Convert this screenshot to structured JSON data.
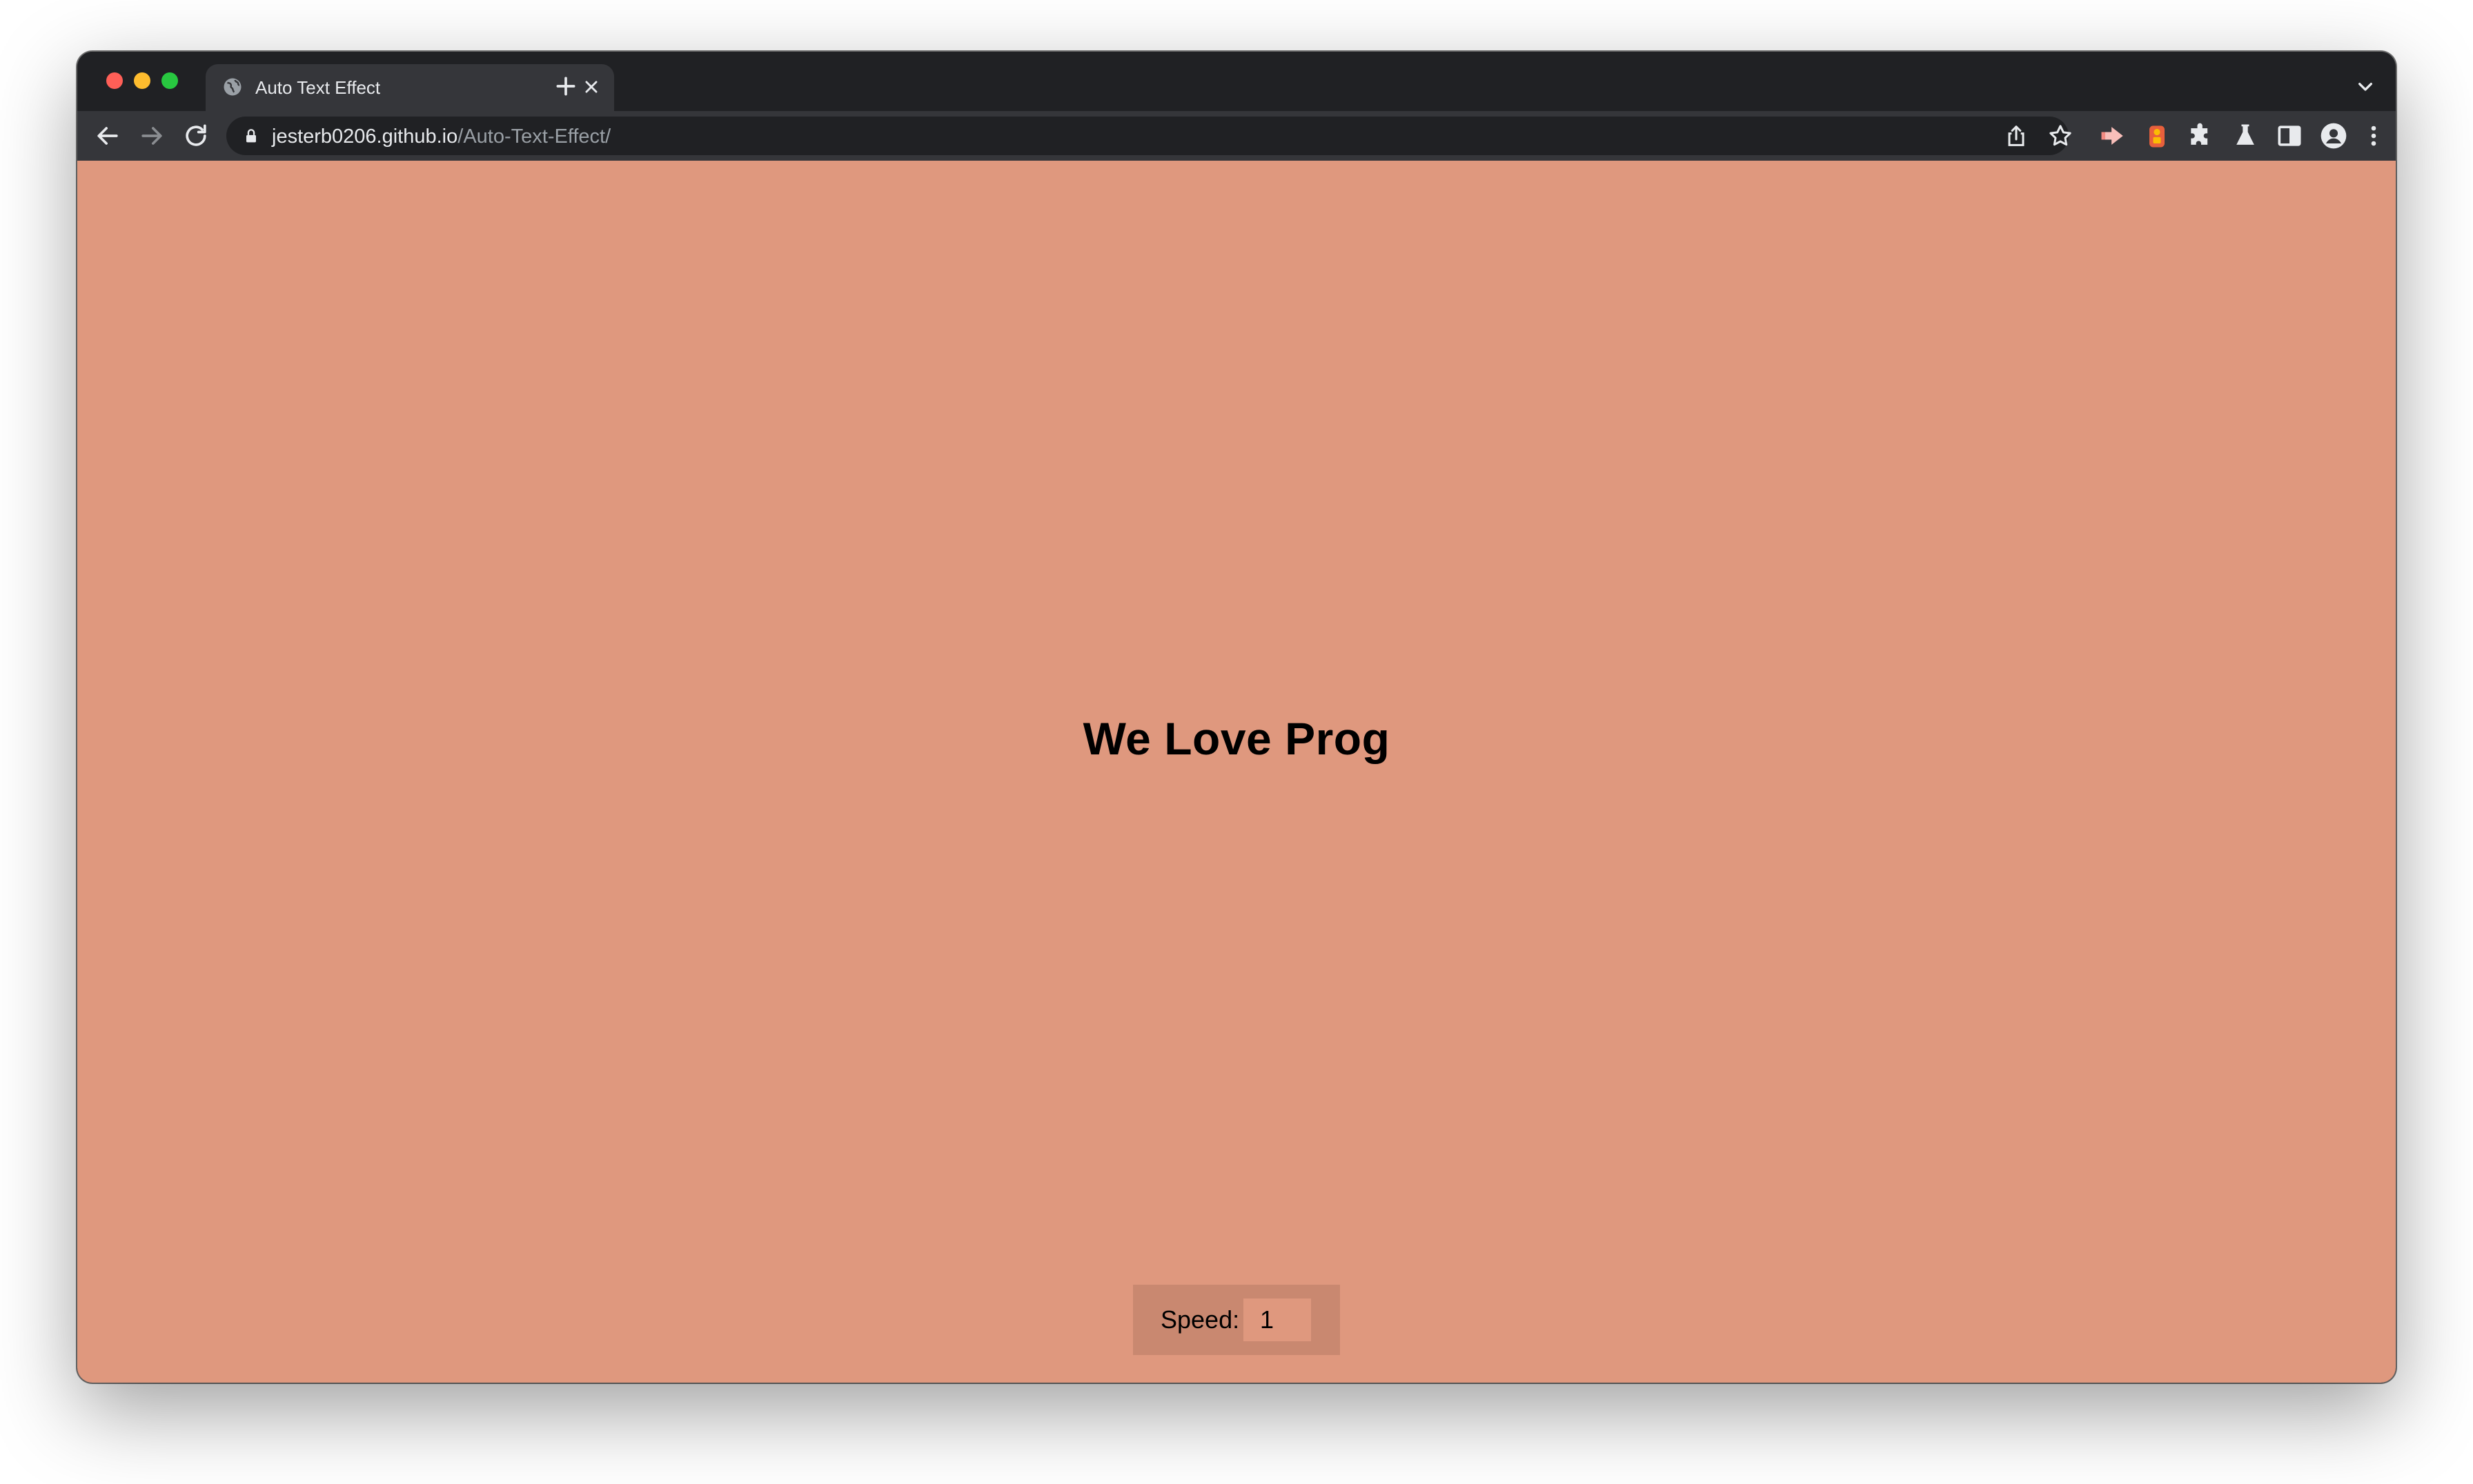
{
  "browser": {
    "tab": {
      "title": "Auto Text Effect"
    },
    "address": {
      "host": "jesterb0206.github.io",
      "path": "/Auto-Text-Effect/"
    },
    "icons": {
      "favicon": "globe-icon",
      "close": "close-icon",
      "new_tab": "plus-icon",
      "tab_search": "chevron-down-icon",
      "back": "arrow-left-icon",
      "forward": "arrow-right-icon",
      "reload": "reload-icon",
      "lock": "lock-icon",
      "share": "share-icon",
      "bookmark": "star-icon",
      "extension_1": "red-extension-icon",
      "extension_2": "orange-extension-icon",
      "extensions": "puzzle-icon",
      "labs": "flask-icon",
      "side_panel": "side-panel-icon",
      "profile": "profile-icon",
      "menu": "kebab-menu-icon"
    },
    "colors": {
      "frame": "#202124",
      "toolbar": "#35363a"
    }
  },
  "page": {
    "headline": "We Love Prog",
    "speed": {
      "label": "Speed:",
      "value": "1"
    },
    "colors": {
      "background": "#df987e",
      "text": "#000000"
    }
  }
}
